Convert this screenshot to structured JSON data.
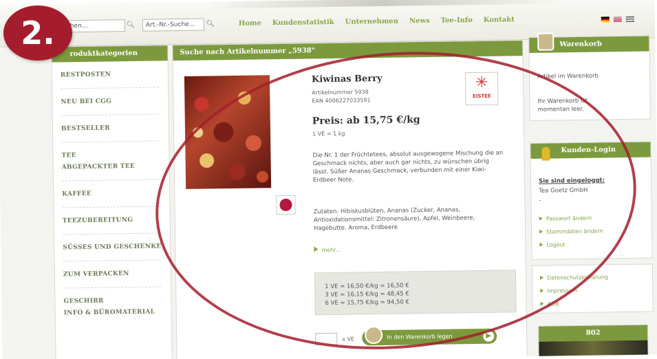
{
  "badge": "2.",
  "header": {
    "search_placeholder": "chen...",
    "artnr_placeholder": "Art.-Nr.-Suche...",
    "nav": [
      "Home",
      "Kundenstatistik",
      "Unternehmen",
      "News",
      "Tee-Info",
      "Kontakt"
    ],
    "flags": [
      "de-flag-icon",
      "uk-flag-icon",
      "menu-icon"
    ]
  },
  "sidebar": {
    "title": "roduktkategorien",
    "items": [
      "RESTPOSTEN",
      "NEU BEI CGG",
      "BESTSELLER",
      "TEE",
      "ABGEPACKTER TEE",
      "KAFFEE",
      "TEEZUBEREITUNG",
      "SÜSSES UND GESCHENKE",
      "ZUM VERPACKEN",
      "GESCHIRR",
      "INFO & BÜROMATERIAL"
    ]
  },
  "main": {
    "heading": "Suche nach Artikelnummer „5938\"",
    "product": {
      "name": "Kiwinas Berry",
      "article": "Artikelnummer 5938",
      "ean": "EAN 4006227033591",
      "price": "Preis: ab 15,75 €/kg",
      "unit": "1 VE = 1 kg",
      "badge_label": "EISTEE",
      "description": "Die Nr. 1 der Früchtetees, absolut ausgewogene Mischung die an Geschmack nichts, aber auch gar nichts, zu wünschen übrig lässt. Süßer Ananas Geschmack, verbunden mit einer Kiwi-Erdbeer Note.",
      "ingredients": "Zutaten: Hibiskusblüten, Ananas (Zucker, Ananas, Antioxidationsmittel: Zitronensäure), Apfel, Weinbeere, Hagebutte. Aroma, Erdbeere",
      "more": "mehr...",
      "tiers": [
        "1 VE = 16,50 €/kg = 16,50 €",
        "3 VE = 16,15 €/kg = 48,45 €",
        "6 VE = 15,75 €/kg = 94,50 €"
      ],
      "qty_unit": "x VE",
      "cart_button": "In den Warenkorb legen"
    }
  },
  "cart": {
    "title": "Warenkorb",
    "items_label": "Artikel im Warenkorb",
    "empty_text": "Ihr Warenkorb ist momentan leer."
  },
  "login": {
    "title": "Kunden-Login",
    "status": "Sie sind eingeloggt:",
    "company": "Tea Goetz GmbH",
    "dash": "-",
    "links": [
      "Passwort ändern",
      "Stammdaten ändern",
      "Logout"
    ]
  },
  "legal": {
    "links": [
      "Datenschutzerklärung",
      "Impressum",
      "AGB"
    ]
  },
  "box": {
    "title": "802"
  },
  "colors": {
    "accent": "#7c9a3d",
    "badge": "#a51d2d",
    "link": "#86a74a"
  }
}
